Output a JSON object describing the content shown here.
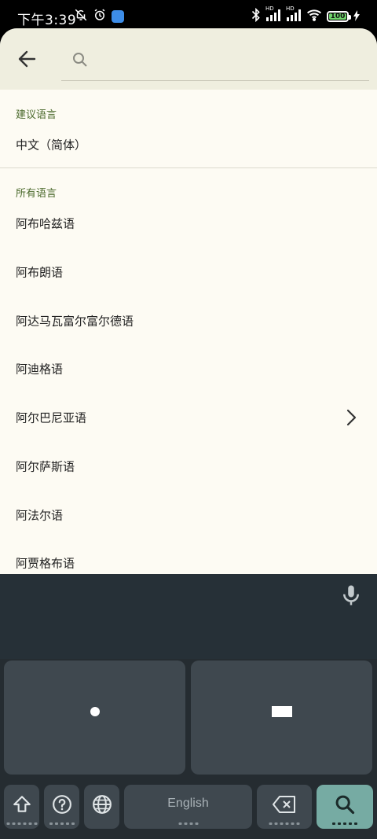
{
  "status_bar": {
    "time": "下午3:39",
    "left_icons": [
      "bell-off-icon",
      "alarm-icon",
      "app-notification-icon"
    ],
    "right_icons": [
      "bluetooth-icon",
      "signal-icon",
      "signal-icon",
      "wifi-icon",
      "battery-icon",
      "charging-icon"
    ],
    "signal_labels": [
      "HD",
      "HD"
    ],
    "battery_level": "100"
  },
  "search": {
    "placeholder": "",
    "value": ""
  },
  "suggested": {
    "header": "建议语言",
    "items": [
      {
        "label": "中文（简体）"
      }
    ]
  },
  "all": {
    "header": "所有语言",
    "items": [
      {
        "label": "阿布哈兹语",
        "has_submenu": false
      },
      {
        "label": "阿布朗语",
        "has_submenu": false
      },
      {
        "label": "阿达马瓦富尔富尔德语",
        "has_submenu": false
      },
      {
        "label": "阿迪格语",
        "has_submenu": false
      },
      {
        "label": "阿尔巴尼亚语",
        "has_submenu": true
      },
      {
        "label": "阿尔萨斯语",
        "has_submenu": false
      },
      {
        "label": "阿法尔语",
        "has_submenu": false
      },
      {
        "label": "阿贾格布语",
        "has_submenu": false
      }
    ]
  },
  "keyboard": {
    "space_label": "English",
    "keys": [
      "dot-key",
      "dash-key",
      "shift-icon",
      "help-icon",
      "globe-icon",
      "backspace-icon",
      "search-icon"
    ],
    "colors": {
      "background": "#252c31",
      "key": "#3f484f",
      "action_key": "#76aba3"
    }
  },
  "colors": {
    "sheet_background": "#fdfbf3",
    "topbar_background": "#efeedf",
    "section_header": "#4b6a2c"
  }
}
